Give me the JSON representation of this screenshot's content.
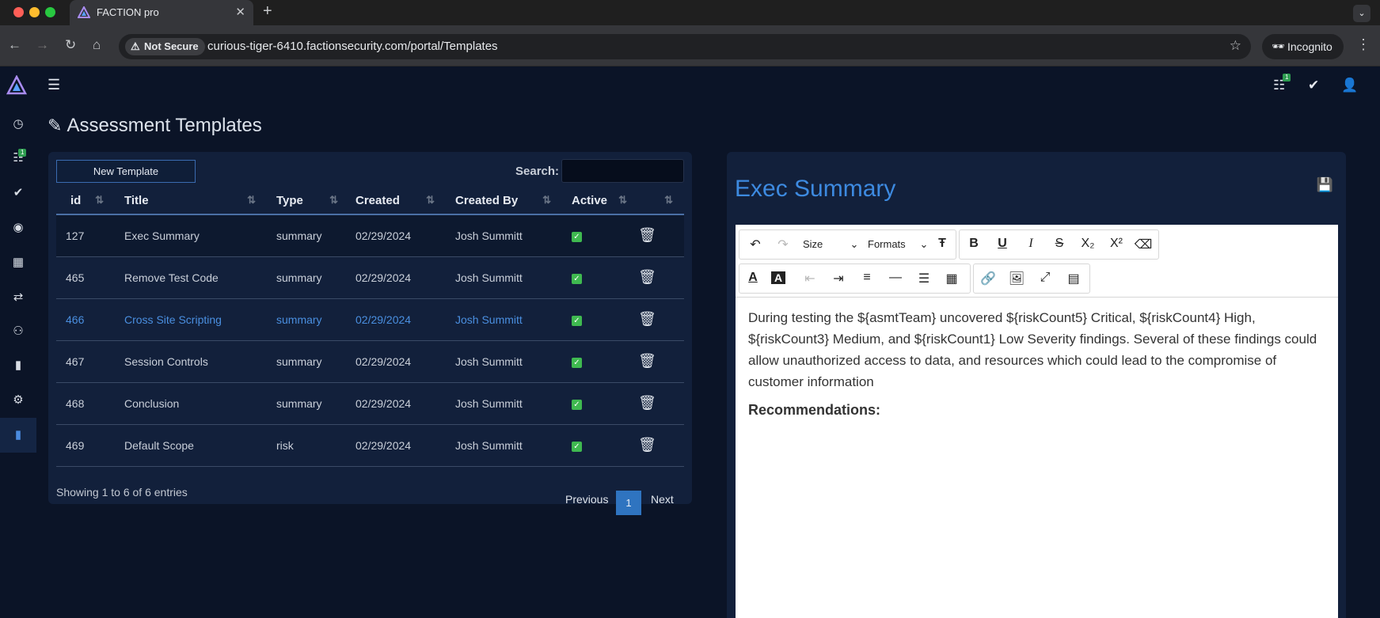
{
  "browser": {
    "tab_title": "FACTION pro",
    "not_secure": "Not Secure",
    "url": "curious-tiger-6410.factionsecurity.com/portal/Templates",
    "incognito": "Incognito"
  },
  "topnav": {
    "queue_badge": "1"
  },
  "sidebar": {
    "badge": "1",
    "items": [
      "dashboard-icon",
      "assessment-queue-icon",
      "verification-icon",
      "retests-icon",
      "calendar-icon",
      "reports-icon",
      "teams-icon",
      "metrics-icon",
      "settings-icon",
      "templates-icon"
    ]
  },
  "page": {
    "title": "Assessment Templates"
  },
  "templates": {
    "new_button": "New Template",
    "search_label": "Search:",
    "columns": [
      "id",
      "Title",
      "Type",
      "Created",
      "Created By",
      "Active"
    ],
    "rows": [
      {
        "id": "127",
        "title": "Exec Summary",
        "type": "summary",
        "created": "02/29/2024",
        "created_by": "Josh Summitt",
        "active": true
      },
      {
        "id": "465",
        "title": "Remove Test Code",
        "type": "summary",
        "created": "02/29/2024",
        "created_by": "Josh Summitt",
        "active": true
      },
      {
        "id": "466",
        "title": "Cross Site Scripting",
        "type": "summary",
        "created": "02/29/2024",
        "created_by": "Josh Summitt",
        "active": true
      },
      {
        "id": "467",
        "title": "Session Controls",
        "type": "summary",
        "created": "02/29/2024",
        "created_by": "Josh Summitt",
        "active": true
      },
      {
        "id": "468",
        "title": "Conclusion",
        "type": "summary",
        "created": "02/29/2024",
        "created_by": "Josh Summitt",
        "active": true
      },
      {
        "id": "469",
        "title": "Default Scope",
        "type": "risk",
        "created": "02/29/2024",
        "created_by": "Josh Summitt",
        "active": true
      }
    ],
    "showing": "Showing 1 to 6 of 6 entries",
    "pagination": {
      "previous": "Previous",
      "current": "1",
      "next": "Next"
    }
  },
  "editor": {
    "title": "Exec Summary",
    "toolbar": {
      "size_label": "Size",
      "formats_label": "Formats"
    },
    "body": "During testing the ${asmtTeam} uncovered ${riskCount5} Critical, ${riskCount4} High, ${riskCount3} Medium, and ${riskCount1} Low Severity findings. Several of these findings could allow unauthorized access to data, and resources which could lead to the compromise of customer information",
    "heading": "Recommendations:"
  },
  "colors": {
    "accent": "#3d8ae0",
    "background": "#0b1427",
    "card": "#12203b",
    "active_check": "#3fb950"
  }
}
